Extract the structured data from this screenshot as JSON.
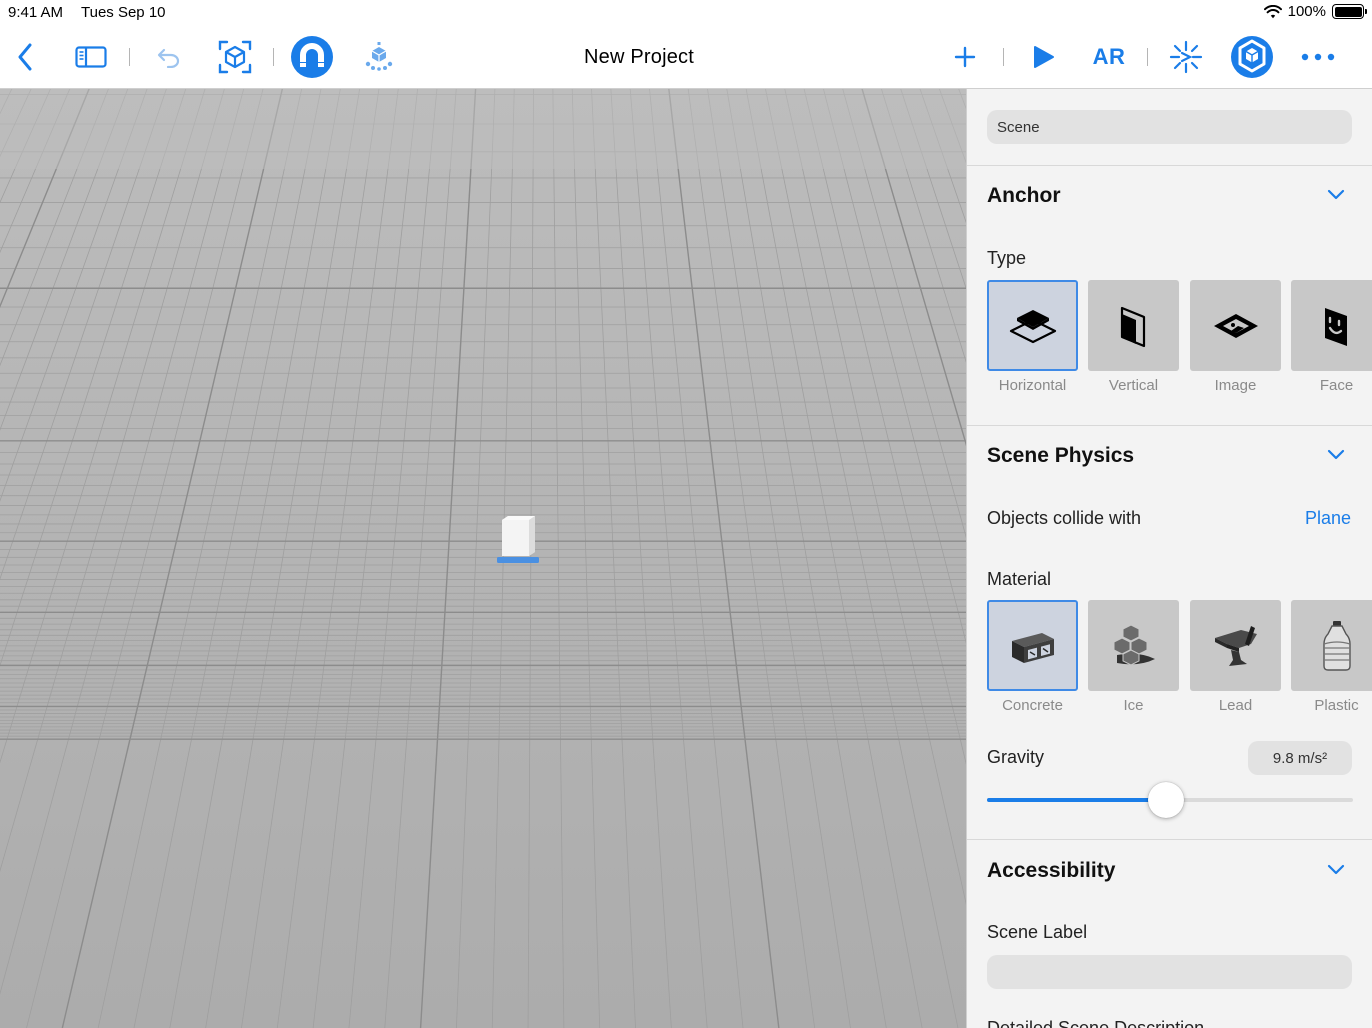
{
  "status": {
    "time": "9:41 AM",
    "date": "Tues Sep 10",
    "battery": "100%"
  },
  "toolbar": {
    "title": "New Project",
    "ar_label": "AR"
  },
  "inspector": {
    "scene_name": "Scene",
    "anchor": {
      "title": "Anchor",
      "type_label": "Type",
      "types": [
        {
          "label": "Horizontal",
          "selected": true
        },
        {
          "label": "Vertical",
          "selected": false
        },
        {
          "label": "Image",
          "selected": false
        },
        {
          "label": "Face",
          "selected": false
        }
      ]
    },
    "physics": {
      "title": "Scene Physics",
      "collide_label": "Objects collide with",
      "collide_value": "Plane",
      "material_label": "Material",
      "materials": [
        {
          "label": "Concrete",
          "selected": true
        },
        {
          "label": "Ice",
          "selected": false
        },
        {
          "label": "Lead",
          "selected": false
        },
        {
          "label": "Plastic",
          "selected": false
        }
      ],
      "gravity_label": "Gravity",
      "gravity_value": "9.8 m/s²",
      "gravity_level": 0.49
    },
    "accessibility": {
      "title": "Accessibility",
      "scene_label": "Scene Label",
      "next_label": "Detailed Scene Description"
    }
  },
  "colors": {
    "accent": "#1a7de8",
    "viewport_bg": "#b2b2b2",
    "panel_bg": "#f3f3f3"
  }
}
